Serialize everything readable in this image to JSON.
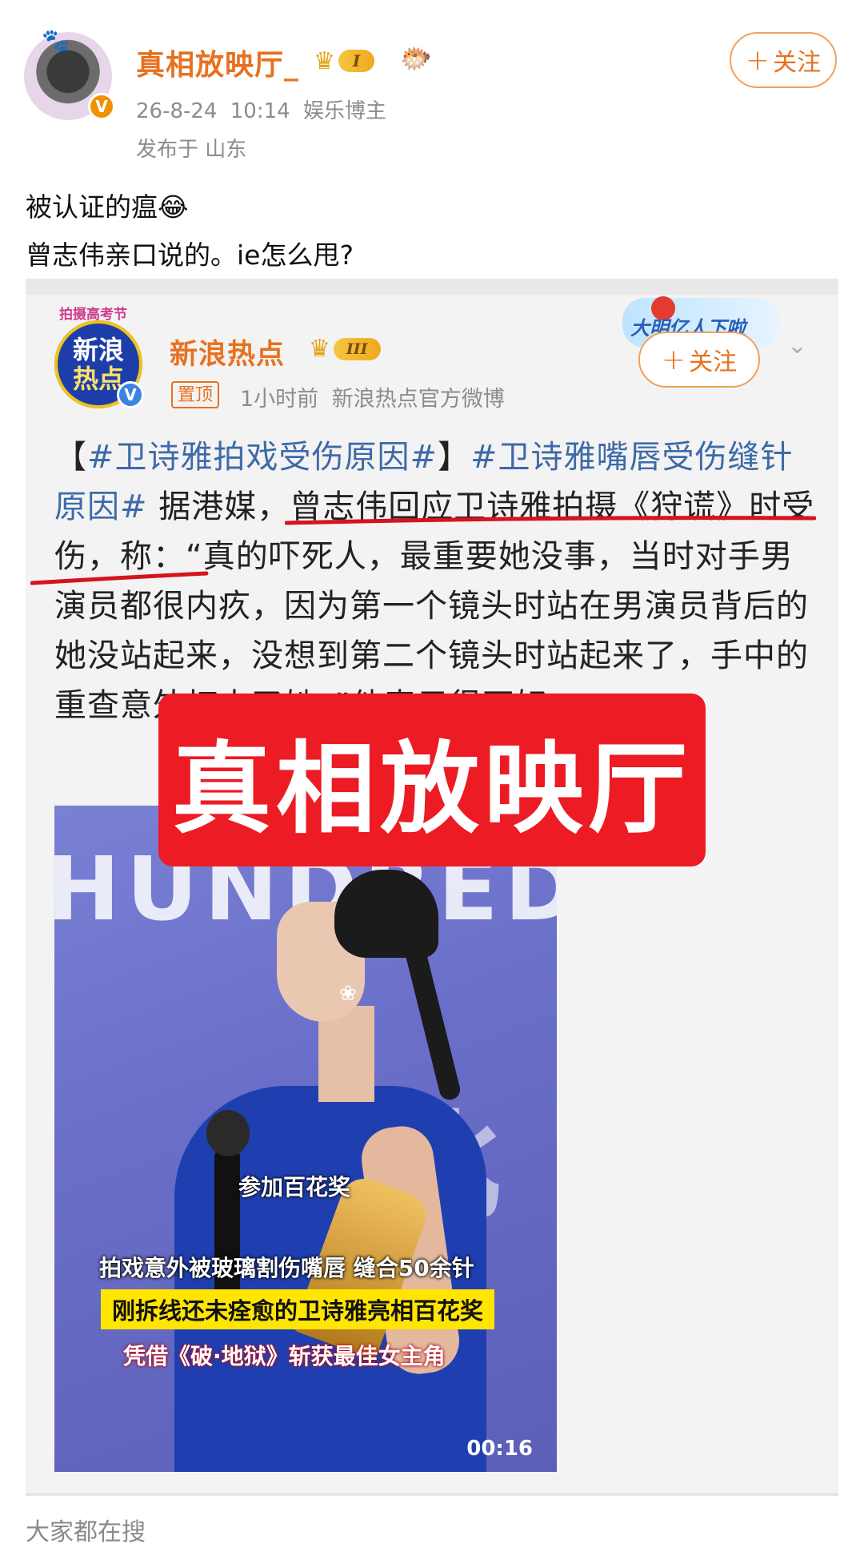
{
  "post": {
    "username": "真相放映厅_",
    "level_badge": "I",
    "timestamp": "26-8-24 10:14",
    "role": "娱乐博主",
    "location": "发布于 山东",
    "follow_label": "关注",
    "text_line1": "被认证的瘟😂",
    "text_line2": "曾志伟亲口说的。ie怎么甩?"
  },
  "repost": {
    "avatar_top": "新浪",
    "avatar_bottom": "热点",
    "avatar_arc": "拍摄高考节",
    "username": "新浪热点",
    "level_badge": "III",
    "pin_label": "置顶",
    "time_ago": "1小时前",
    "source": "新浪热点官方微博",
    "follow_label": "关注",
    "follow_deco_text": "大明亿人下啦",
    "body": {
      "p1": "【",
      "tag1": "#卫诗雅拍戏受伤原因#",
      "p2": "】",
      "tag2": "#卫诗雅嘴唇受伤缝针原因#",
      "p3": " 据港媒，曾志伟回应卫诗雅拍摄《狩谎》时受伤，称：“真的吓死人，最重要她没事，当时对手男演员都很内疚，因为第一个镜头时站在男演员背后的她没站起来，没想到第二个镜头时站起来了，手中的重查意外打中了她。”他表示很不好"
    },
    "watermark": "真相放映厅",
    "video": {
      "bg_text": "HUNDRED",
      "caption_top": "参加百花奖",
      "caption_1": "拍戏意外被玻璃割伤嘴唇 缝合50余针",
      "caption_2": "刚拆线还未痊愈的卫诗雅亮相百花奖",
      "caption_3": "凭借《破·地狱》斩获最佳女主角",
      "duration": "00:16"
    }
  },
  "footer": {
    "search_hint": "大家都在搜"
  },
  "colors": {
    "username_orange": "#e8711f",
    "hashtag_blue": "#3e6aa8",
    "watermark_red": "#ec1b24",
    "underline_red": "#d4141e",
    "caption_yellow": "#ffe500"
  }
}
